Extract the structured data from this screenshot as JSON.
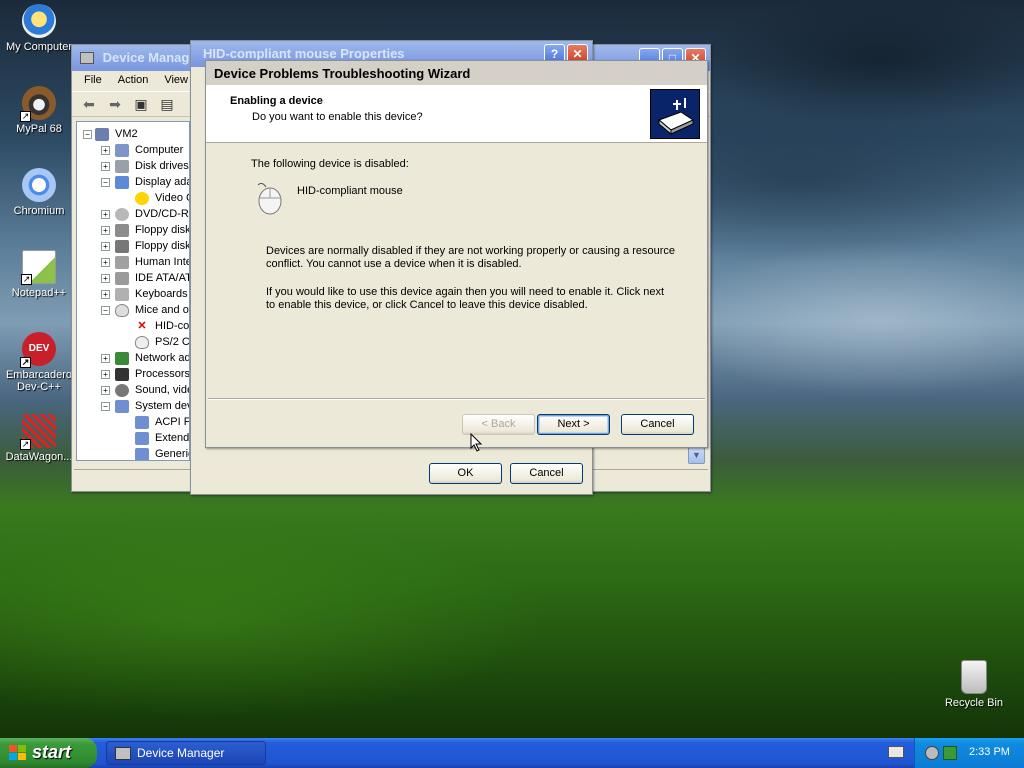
{
  "desktop": {
    "icons": [
      {
        "label": "My Computer"
      },
      {
        "label": "MyPal 68"
      },
      {
        "label": "Chromium"
      },
      {
        "label": "Notepad++"
      },
      {
        "label": "Embarcadero Dev-C++"
      },
      {
        "label": "DataWagon..."
      },
      {
        "label": "Recycle Bin"
      }
    ]
  },
  "device_manager": {
    "title": "Device Manager",
    "menu": [
      "File",
      "Action",
      "View"
    ],
    "tree": {
      "root": "VM2",
      "items": [
        "Computer",
        "Disk drives",
        "Display ada",
        "Video C",
        "DVD/CD-RO",
        "Floppy disk",
        "Floppy disk",
        "Human Inte",
        "IDE ATA/AT",
        "Keyboards",
        "Mice and ot",
        "HID-co",
        "PS/2 Co",
        "Network ad",
        "Processors",
        "Sound, vide",
        "System dev",
        "ACPI Fi",
        "Extend",
        "Generic"
      ]
    }
  },
  "properties": {
    "title": "HID-compliant mouse Properties",
    "ok_label": "OK",
    "cancel_label": "Cancel"
  },
  "wizard": {
    "title": "Device Problems Troubleshooting Wizard",
    "heading": "Enabling a device",
    "subheading": "Do you want to enable this device?",
    "disabled_intro": "The following device is disabled:",
    "device_name": "HID-compliant mouse",
    "paragraph1": "Devices are normally disabled if they are not working properly or causing a resource conflict. You cannot use a device when it is disabled.",
    "paragraph2": "If you would like to use this device again then you will need to enable it. Click next to enable this device, or click Cancel to leave this device disabled.",
    "back_label": "< Back",
    "next_label": "Next >",
    "cancel_label": "Cancel"
  },
  "taskbar": {
    "start_label": "start",
    "task_label": "Device Manager",
    "clock": "2:33 PM"
  }
}
